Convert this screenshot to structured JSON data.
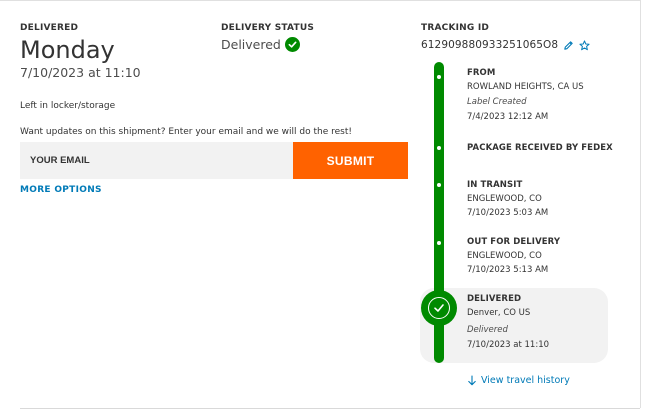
{
  "delivered": {
    "label": "DELIVERED",
    "day": "Monday",
    "datetime": "7/10/2023 at 11:10"
  },
  "status": {
    "label": "DELIVERY STATUS",
    "value": "Delivered",
    "color": "#008a00"
  },
  "tracking": {
    "label": "TRACKING ID",
    "number": "612909880933251065O8",
    "edit_icon": "pencil-icon",
    "favorite_icon": "star-icon"
  },
  "left_note": "Left in locker/storage",
  "updates": {
    "text": "Want updates on this shipment? Enter your email and we will do the rest!",
    "email_placeholder": "YOUR EMAIL",
    "submit_label": "SUBMIT",
    "more_options_label": "MORE OPTIONS",
    "accent": "#ff6200",
    "link_color": "#007ab7"
  },
  "timeline": [
    {
      "title": "FROM",
      "line1": "ROWLAND HEIGHTS, CA US",
      "note": "Label Created",
      "time": "7/4/2023 12:12 AM"
    },
    {
      "title": "PACKAGE RECEIVED BY FEDEX"
    },
    {
      "title": "IN TRANSIT",
      "line1": "ENGLEWOOD, CO",
      "time": "7/10/2023 5:03 AM"
    },
    {
      "title": "OUT FOR DELIVERY",
      "line1": "ENGLEWOOD, CO",
      "time": "7/10/2023 5:13 AM"
    },
    {
      "title": "DELIVERED",
      "line1": "Denver, CO US",
      "note": "Delivered",
      "time": "7/10/2023 at 11:10"
    }
  ],
  "travel_history_label": "View travel history"
}
